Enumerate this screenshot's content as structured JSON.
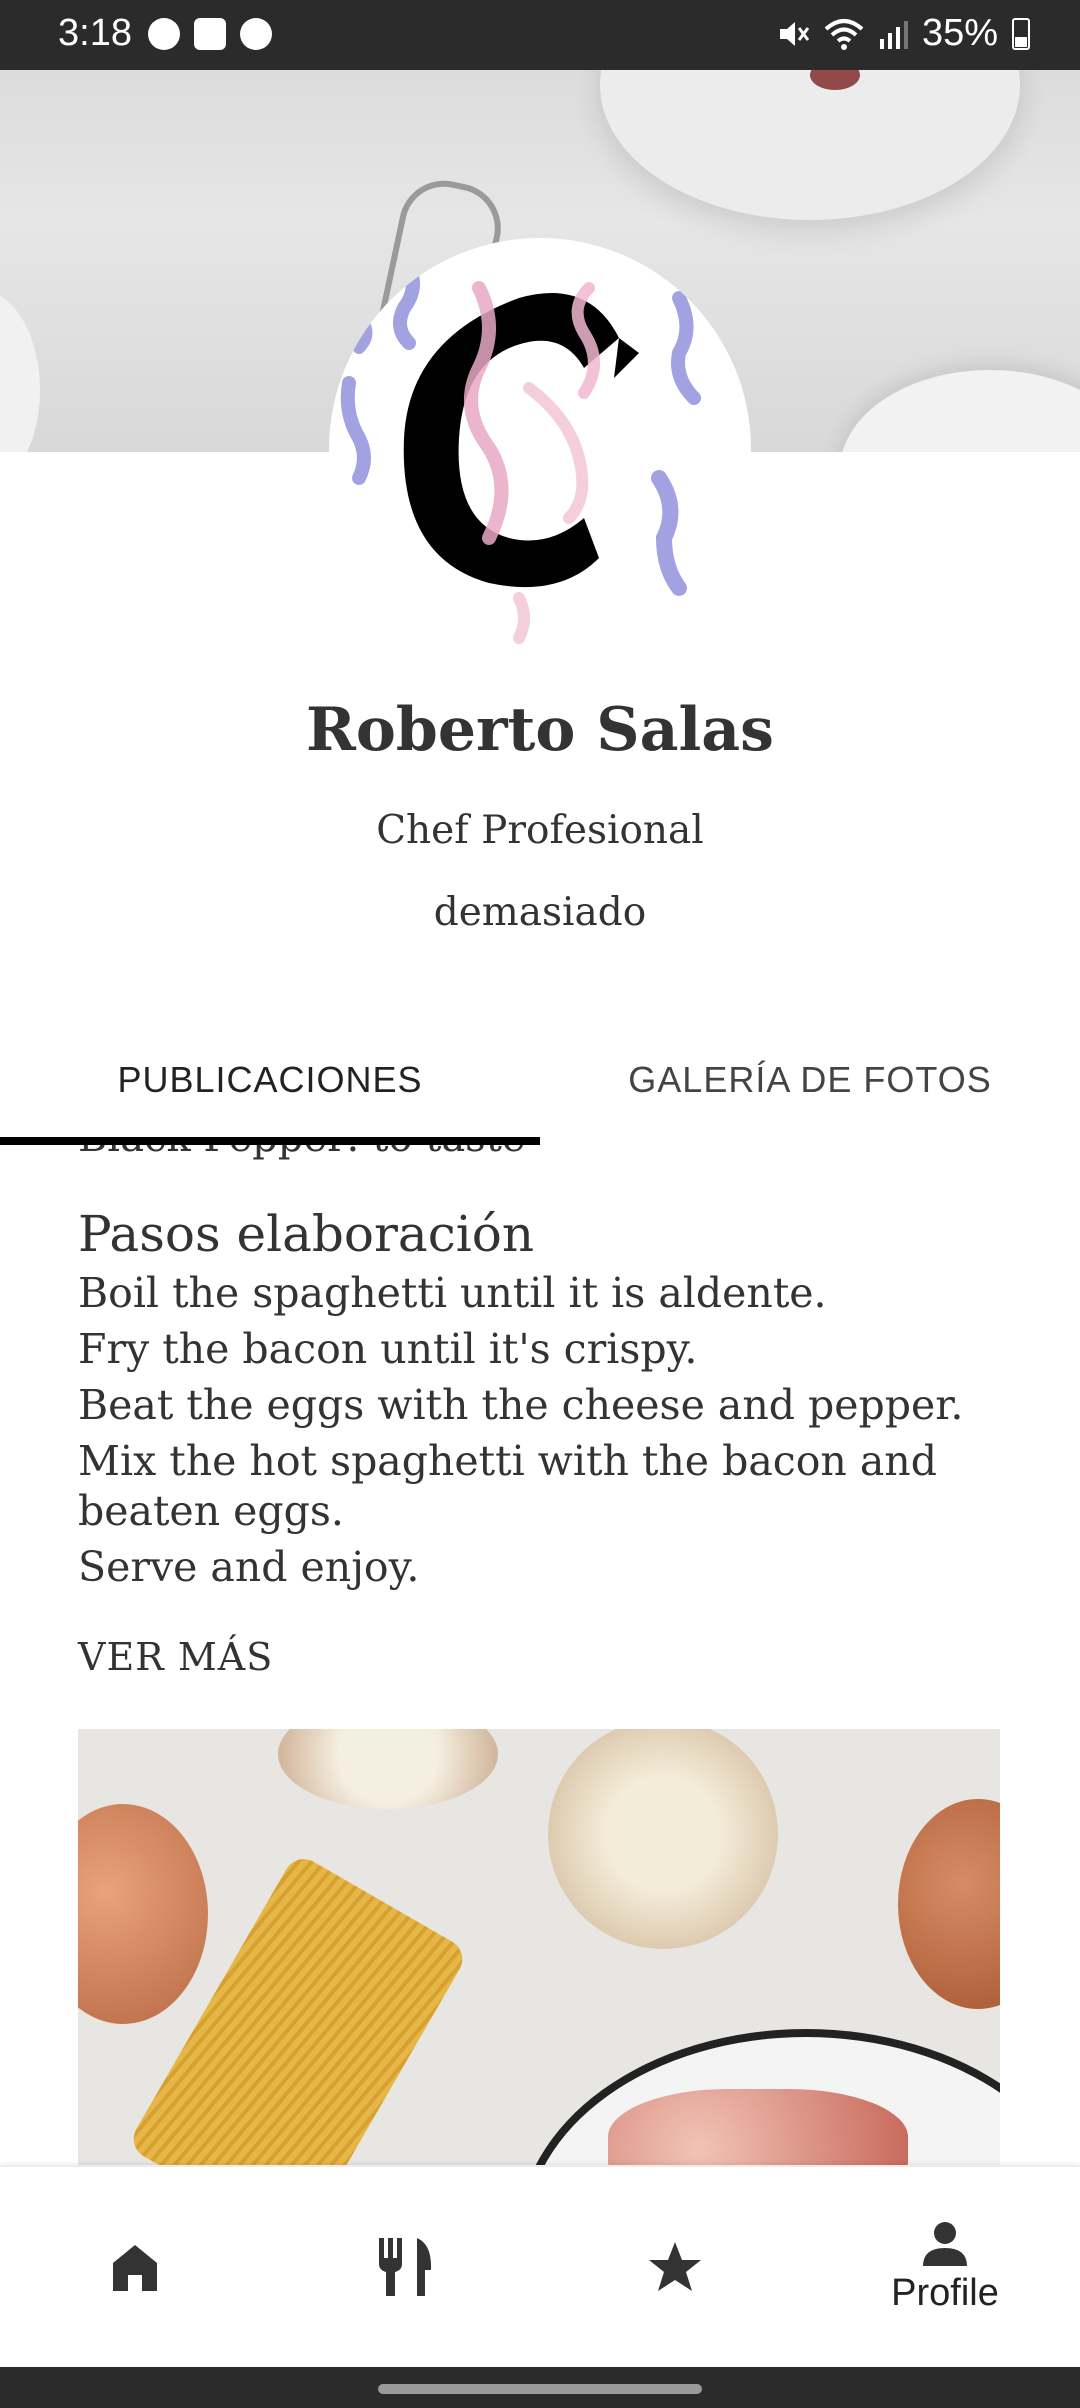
{
  "status_bar": {
    "time": "3:18",
    "battery": "35%",
    "icons": [
      "game-icon",
      "gallery-icon",
      "cat-app-icon",
      "mute-icon",
      "wifi-icon",
      "signal-icon",
      "battery-icon"
    ]
  },
  "profile": {
    "name": "Roberto Salas",
    "title": "Chef Profesional",
    "bio": "demasiado"
  },
  "tabs": [
    {
      "label": "PUBLICACIONES",
      "active": true
    },
    {
      "label": "GALERÍA DE FOTOS",
      "active": false
    }
  ],
  "post": {
    "cut_line": "Black Pepper: to taste",
    "steps_title": "Pasos elaboración",
    "steps": [
      "Boil the spaghetti until it is aldente.",
      "Fry the bacon until it's crispy.",
      "Beat the eggs with the cheese and pepper.",
      "Mix the hot spaghetti with the bacon and beaten eggs.",
      "Serve and enjoy."
    ],
    "ver_mas": "VER MÁS"
  },
  "bottom_nav": {
    "items": [
      {
        "icon": "home-icon"
      },
      {
        "icon": "fork-knife-icon"
      },
      {
        "icon": "star-icon"
      },
      {
        "icon": "person-icon",
        "label": "Profile",
        "active": true
      }
    ]
  }
}
